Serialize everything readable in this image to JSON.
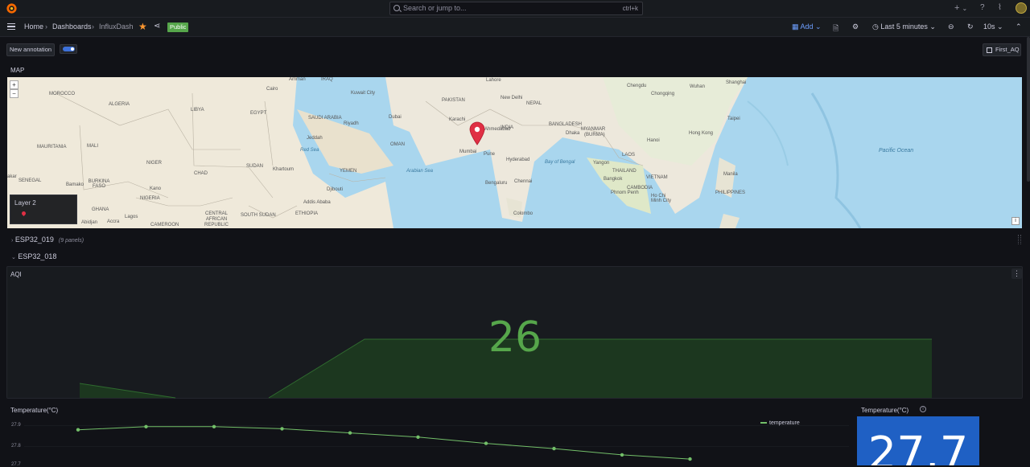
{
  "topbar": {
    "search_placeholder": "Search or jump to...",
    "search_shortcut": "ctrl+k",
    "plus": "+",
    "plus_chevron": "⌄"
  },
  "navbar": {
    "breadcrumbs": [
      "Home",
      "Dashboards",
      "InfluxDash"
    ],
    "separator": "›",
    "public_badge": "Public",
    "add_label": "Add",
    "time_range": "Last 5 minutes",
    "refresh_interval": "10s"
  },
  "annotations": {
    "new_annotation_label": "New annotation",
    "toggle_on": true,
    "link_label": "First_AQ"
  },
  "map_panel": {
    "title": "MAP",
    "zoom_in": "+",
    "zoom_out": "−",
    "layer_label": "Layer 2",
    "info": "i",
    "labels": {
      "amman": "Amman",
      "iraq": "IRAQ",
      "lahore": "Lahore",
      "chengdu": "Chengdu",
      "wuhan": "Wuhan",
      "shanghai": "Shanghai",
      "morocco": "MOROCCO",
      "cairo": "Cairo",
      "kuwait_city": "Kuwait City",
      "pakistan": "PAKISTAN",
      "new_delhi": "New Delhi",
      "nepal": "NEPAL",
      "chongqing": "Chongqing",
      "algeria": "ALGERIA",
      "libya": "LIBYA",
      "egypt": "EGYPT",
      "saudi_arabia": "SAUDI ARABIA",
      "riyadh": "Riyadh",
      "dubai": "Dubai",
      "karachi": "Karachi",
      "ahmedabad": "Ahmedabad",
      "india": "INDIA",
      "bangladesh": "BANGLADESH",
      "myanmar": "MYANMAR",
      "burma": "(BURMA)",
      "dhaka": "Dhaka",
      "taipei": "Taipei",
      "jeddah": "Jeddah",
      "oman": "OMAN",
      "mumbai": "Mumbai",
      "pune": "Pune",
      "hanoi": "Hanoi",
      "hong_kong": "Hong Kong",
      "mauritania": "MAURITANIA",
      "mali": "MALI",
      "red_sea": "Red Sea",
      "hyderabad": "Hyderabad",
      "bay_of_bengal": "Bay of Bengal",
      "yangon": "Yangon",
      "laos": "LAOS",
      "pacific_ocean": "Pacific Ocean",
      "niger": "NIGER",
      "chad": "CHAD",
      "sudan": "SUDAN",
      "khartoum": "Khartoum",
      "yemen": "YEMEN",
      "arabian_sea": "Arabian Sea",
      "thailand": "THAILAND",
      "manila": "Manila",
      "senegal": "SENEGAL",
      "burkina_faso": "BURKINA FASO",
      "bamako": "Bamako",
      "bengaluru": "Bengaluru",
      "chennai": "Chennai",
      "bangkok": "Bangkok",
      "vietnam": "VIETNAM",
      "kano": "Kano",
      "djibouti": "Djibouti",
      "cambodia": "CAMBODIA",
      "philippines": "PHILIPPINES",
      "phnom_penh": "Phnom Penh",
      "ho_chi_minh_city": "Ho Chi Minh City",
      "nigeria": "NIGERIA",
      "addis_ababa": "Addis Ababa",
      "ghana": "GHANA",
      "central_african_republic": "CENTRAL AFRICAN REPUBLIC",
      "south_sudan": "SOUTH SUDAN",
      "ethiopia": "ETHIOPIA",
      "colombo": "Colombo",
      "lagos": "Lagos",
      "abidjan": "Abidjan",
      "accra": "Accra",
      "cameroon": "CAMEROON",
      "dakar": "akar"
    }
  },
  "rows": {
    "row1_title": "ESP32_019",
    "row1_count": "(9 panels)",
    "row2_title": "ESP32_018"
  },
  "aqi_panel": {
    "title": "AQI",
    "value": "26",
    "color": "#56a64b"
  },
  "temp_panel": {
    "title": "Temperature(°C)",
    "legend": "temperature",
    "y_ticks": [
      "27.9",
      "27.8",
      "27.7"
    ],
    "points": [
      27.88,
      27.895,
      27.895,
      27.885,
      27.865,
      27.845,
      27.815,
      27.79,
      27.76,
      27.74
    ]
  },
  "temp_stat": {
    "title": "Temperature(°C)",
    "value": "27.7",
    "color": "#1f60c4"
  }
}
